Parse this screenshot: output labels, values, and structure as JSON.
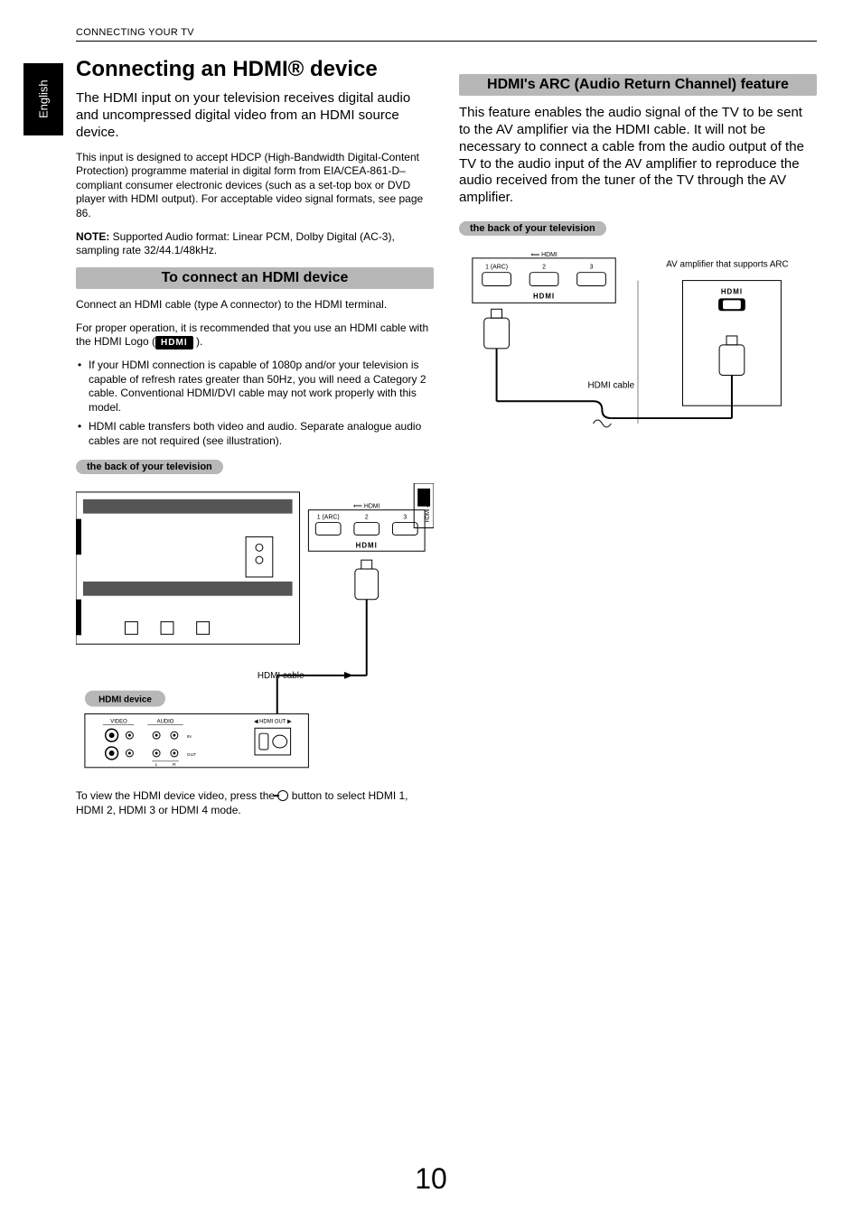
{
  "header": {
    "breadcrumb": "CONNECTING YOUR TV",
    "language_tab": "English"
  },
  "page_number": "10",
  "left": {
    "h1": "Connecting an HDMI® device",
    "intro": "The HDMI input on your television receives digital audio and uncompressed digital video from an HDMI source device.",
    "p1": "This input is designed to accept HDCP (High-Bandwidth Digital-Content Protection) programme material in digital form from EIA/CEA-861-D–compliant consumer electronic devices (such as a set-top box or DVD player with HDMI output). For acceptable video signal formats, see page 86.",
    "note_label": "NOTE:",
    "note_text": " Supported Audio format: Linear PCM, Dolby Digital (AC-3), sampling rate 32/44.1/48kHz.",
    "section_bar": "To connect an HDMI device",
    "p2": "Connect an HDMI cable (type A connector) to the HDMI terminal.",
    "p3a": "For proper operation, it is recommended that you use an HDMI cable with the HDMI Logo (",
    "hdmi_logo": "HDMI",
    "p3b": " ).",
    "bullets": [
      "If your HDMI connection is capable of 1080p and/or your television is capable of refresh rates greater than 50Hz, you will need a Category 2 cable. Conventional HDMI/DVI cable may not work properly with this model.",
      "HDMI cable transfers both video and audio. Separate analogue audio cables are not required (see illustration)."
    ],
    "pill_back": "the back of your television",
    "pill_device": "HDMI device",
    "diagram": {
      "hdmi4_top": "HDMI 4",
      "port_label_arc": "1 (ARC)",
      "port_label_2": "2",
      "port_label_3": "3",
      "hdmi_word": "HDMI",
      "cable_label": "HDMI cable",
      "dev_video": "VIDEO",
      "dev_audio": "AUDIO",
      "dev_hdmi_out": "HDMI OUT",
      "dev_l": "L",
      "dev_r": "R",
      "dev_in": "IN",
      "dev_out": "OUT"
    },
    "footer_a": "To view the HDMI device video, press the ",
    "footer_b": " button to select HDMI 1, HDMI 2, HDMI 3 or HDMI 4 mode."
  },
  "right": {
    "section_bar": "HDMI's ARC (Audio Return Channel) feature",
    "p1": "This feature enables the audio signal of the TV to be sent to the AV amplifier via the HDMI cable. It will not be necessary to connect a cable from the audio output of the TV to the audio input of the AV amplifier to reproduce the audio received from the tuner of the TV through the AV amplifier.",
    "pill_back": "the back of your television",
    "diagram": {
      "amp_label": "AV amplifier that supports ARC",
      "port_label_arc": "1 (ARC)",
      "port_label_2": "2",
      "port_label_3": "3",
      "hdmi_word": "HDMI",
      "cable_label": "HDMI cable"
    }
  }
}
